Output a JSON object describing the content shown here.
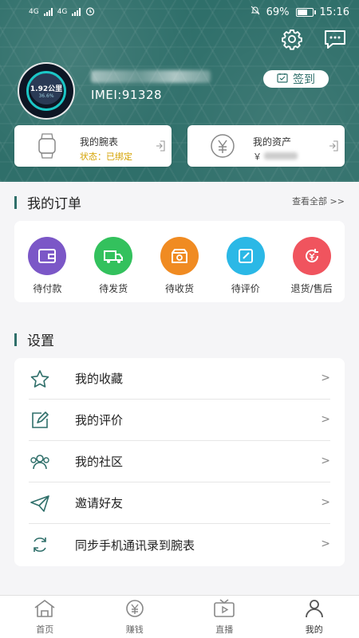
{
  "statusbar": {
    "net1": "4G",
    "net2": "4G",
    "battery_pct": "69%",
    "time": "15:16"
  },
  "profile": {
    "imei": "IMEI:91328",
    "signin_label": "签到",
    "watch_face_big": "1.92公里",
    "watch_face_small": "36.6%"
  },
  "cards": {
    "watch": {
      "title": "我的腕表",
      "status": "状态：已绑定"
    },
    "asset": {
      "title": "我的资产",
      "currency": "￥"
    }
  },
  "orders": {
    "title": "我的订单",
    "view_all": "查看全部 >>",
    "items": [
      {
        "label": "待付款",
        "color": "#7b57c7",
        "icon": "wallet-icon"
      },
      {
        "label": "待发货",
        "color": "#33c15d",
        "icon": "truck-icon"
      },
      {
        "label": "待收货",
        "color": "#f08b22",
        "icon": "box-icon"
      },
      {
        "label": "待评价",
        "color": "#2bb8e6",
        "icon": "edit-icon"
      },
      {
        "label": "退货/售后",
        "color": "#f0545e",
        "icon": "refund-icon"
      }
    ]
  },
  "settings": {
    "title": "设置",
    "items": [
      {
        "label": "我的收藏",
        "icon": "star-icon"
      },
      {
        "label": "我的评价",
        "icon": "edit-icon"
      },
      {
        "label": "我的社区",
        "icon": "community-icon"
      },
      {
        "label": "邀请好友",
        "icon": "send-icon"
      },
      {
        "label": "同步手机通讯录到腕表",
        "icon": "sync-icon"
      }
    ],
    "chevron": ">"
  },
  "nav": {
    "items": [
      {
        "label": "首页",
        "icon": "home-icon"
      },
      {
        "label": "赚钱",
        "icon": "yen-coin-icon"
      },
      {
        "label": "直播",
        "icon": "tv-icon"
      },
      {
        "label": "我的",
        "icon": "profile-icon"
      }
    ]
  },
  "colors": {
    "brand": "#2f6f6a",
    "status_yellow": "#d4a200"
  }
}
